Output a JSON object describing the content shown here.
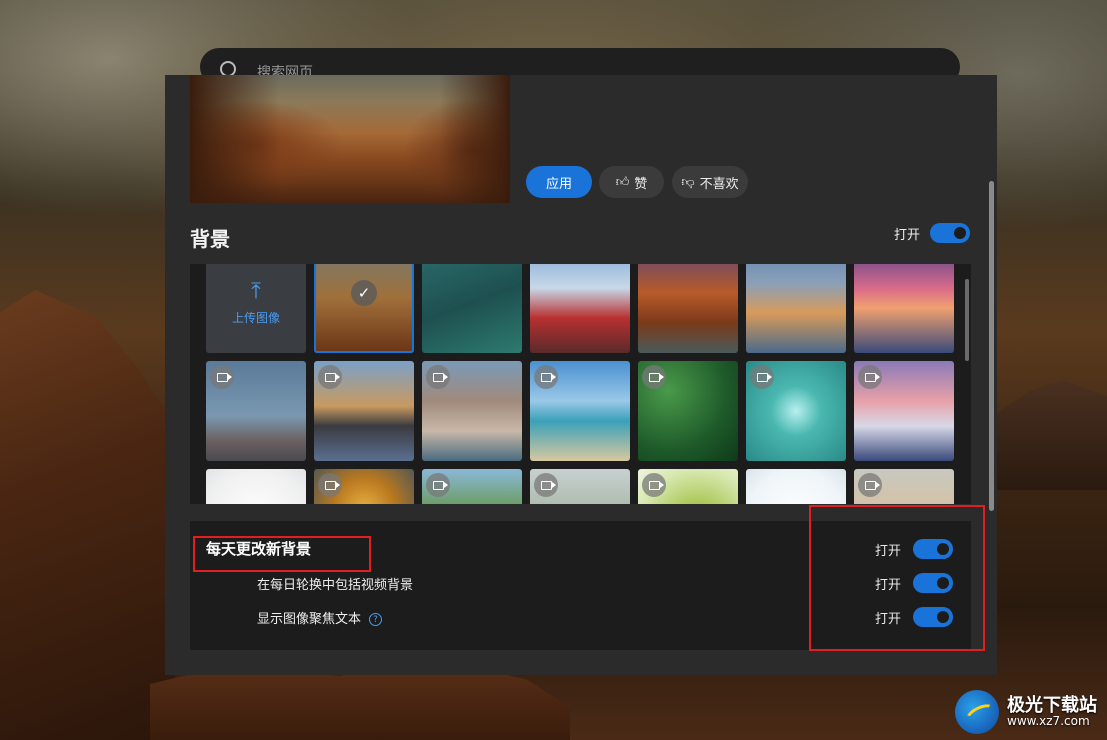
{
  "search": {
    "placeholder": "搜索网页"
  },
  "actions": {
    "apply": "应用",
    "like": "赞",
    "dislike": "不喜欢"
  },
  "background": {
    "title": "背景",
    "toggle_label": "打开",
    "toggle_on": true
  },
  "gallery": {
    "upload_label": "上传图像",
    "tiles": [
      {
        "kind": "upload"
      },
      {
        "kind": "image",
        "selected": true,
        "video": false,
        "scene": "desert-canyon"
      },
      {
        "kind": "image",
        "video": false,
        "scene": "aerial-sea"
      },
      {
        "kind": "image",
        "video": false,
        "scene": "mount-fuji-pagoda"
      },
      {
        "kind": "image",
        "video": false,
        "scene": "canyon-river"
      },
      {
        "kind": "image",
        "video": false,
        "scene": "harbor-town"
      },
      {
        "kind": "image",
        "video": false,
        "scene": "pier-sunset"
      },
      {
        "kind": "image",
        "video": true,
        "scene": "mountain-dusk"
      },
      {
        "kind": "image",
        "video": true,
        "scene": "city-skyline"
      },
      {
        "kind": "image",
        "video": true,
        "scene": "old-town-river"
      },
      {
        "kind": "image",
        "video": true,
        "scene": "beach"
      },
      {
        "kind": "image",
        "video": true,
        "scene": "forest-aerial"
      },
      {
        "kind": "image",
        "video": true,
        "scene": "water-drop"
      },
      {
        "kind": "image",
        "video": true,
        "scene": "santorini-sunset"
      },
      {
        "kind": "image",
        "video": false,
        "scene": "white-flowers"
      },
      {
        "kind": "image",
        "video": true,
        "scene": "coral-reef"
      },
      {
        "kind": "image",
        "video": true,
        "scene": "green-hills"
      },
      {
        "kind": "image",
        "video": true,
        "scene": "misty-valley"
      },
      {
        "kind": "image",
        "video": true,
        "scene": "ladybug-leaf"
      },
      {
        "kind": "image",
        "video": false,
        "scene": "white-splash"
      },
      {
        "kind": "image",
        "video": true,
        "scene": "sand-dunes"
      }
    ]
  },
  "daily": {
    "title": "每天更改新背景",
    "rows": [
      {
        "label": "每天更改新背景",
        "state": "打开",
        "on": true
      },
      {
        "label": "在每日轮换中包括视频背景",
        "state": "打开",
        "on": true
      },
      {
        "label": "显示图像聚焦文本",
        "state": "打开",
        "on": true,
        "help": "?"
      }
    ]
  },
  "watermark": {
    "name": "极光下载站",
    "url": "www.xz7.com"
  },
  "colors": {
    "accent": "#1a73d8",
    "highlight": "#e02020",
    "panel": "#2b2b2b"
  }
}
